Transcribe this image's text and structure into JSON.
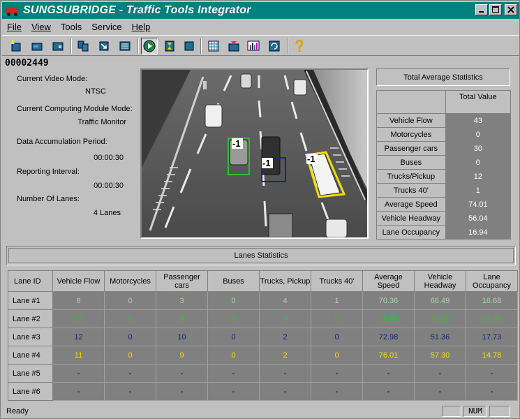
{
  "window": {
    "title": "SUNGSUBRIDGE - Traffic Tools Integrator"
  },
  "menu": [
    "File",
    "View",
    "Tools",
    "Service",
    "Help"
  ],
  "counter": "00002449",
  "info": {
    "video_mode_label": "Current Video Mode:",
    "video_mode_value": "NTSC",
    "module_mode_label": "Current Computing Module Mode:",
    "module_mode_value": "Traffic Monitor",
    "accum_label": "Data Accumulation Period:",
    "accum_value": "00:00:30",
    "report_label": "Reporting Interval:",
    "report_value": "00:00:30",
    "lanes_label": "Number Of Lanes:",
    "lanes_value": "4 Lanes"
  },
  "video": {
    "detection_labels": [
      "-1",
      "-1",
      "-1"
    ]
  },
  "totals": {
    "header": "Total Average Statistics",
    "column": "Total Value",
    "rows": [
      {
        "label": "Vehicle Flow",
        "value": "43"
      },
      {
        "label": "Motorcycles",
        "value": "0"
      },
      {
        "label": "Passenger cars",
        "value": "30"
      },
      {
        "label": "Buses",
        "value": "0"
      },
      {
        "label": "Trucks/Pickup",
        "value": "12"
      },
      {
        "label": "Trucks 40'",
        "value": "1"
      },
      {
        "label": "Average Speed",
        "value": "74.01"
      },
      {
        "label": "Vehicle Headway",
        "value": "56.04"
      },
      {
        "label": "Lane Occupancy",
        "value": "16.94"
      }
    ]
  },
  "lanes": {
    "header": "Lanes Statistics",
    "columns": [
      "Lane ID",
      "Vehicle Flow",
      "Motorcycles",
      "Passenger cars",
      "Buses",
      "Trucks, Pickup",
      "Trucks 40'",
      "Average Speed",
      "Vehicle Headway",
      "Lane Occupancy"
    ],
    "rows": [
      {
        "id": "Lane #1",
        "color": "#a8d4b0",
        "values": [
          "8",
          "0",
          "3",
          "0",
          "4",
          "1",
          "70.36",
          "66.49",
          "16.68"
        ]
      },
      {
        "id": "Lane #2",
        "color": "#3cb83c",
        "values": [
          "12",
          "0",
          "8",
          "0",
          "4",
          "0",
          "75.88",
          "49.02",
          "18.58"
        ]
      },
      {
        "id": "Lane #3",
        "color": "#1c1c78",
        "values": [
          "12",
          "0",
          "10",
          "0",
          "2",
          "0",
          "72.98",
          "51.36",
          "17.73"
        ]
      },
      {
        "id": "Lane #4",
        "color": "#f0e000",
        "values": [
          "11",
          "0",
          "9",
          "0",
          "2",
          "0",
          "76.01",
          "57.30",
          "14.78"
        ]
      },
      {
        "id": "Lane #5",
        "color": "#000000",
        "values": [
          "-",
          "-",
          "-",
          "-",
          "-",
          "-",
          "-",
          "-",
          "-"
        ]
      },
      {
        "id": "Lane #6",
        "color": "#000000",
        "values": [
          "-",
          "-",
          "-",
          "-",
          "-",
          "-",
          "-",
          "-",
          "-"
        ]
      }
    ]
  },
  "status": {
    "text": "Ready",
    "num": "NUM"
  }
}
